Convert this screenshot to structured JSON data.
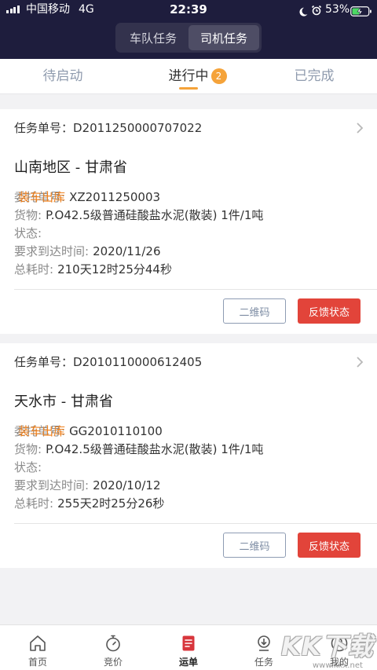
{
  "status_bar": {
    "carrier": "中国移动",
    "network": "4G",
    "time": "22:39",
    "battery": "53%",
    "icons": [
      "signal-icon",
      "moon-icon",
      "alarm-icon",
      "battery-charging-icon"
    ]
  },
  "header": {
    "segments": [
      {
        "label": "车队任务",
        "active": false
      },
      {
        "label": "司机任务",
        "active": true
      }
    ]
  },
  "tabs": [
    {
      "label": "待启动",
      "active": false
    },
    {
      "label": "进行中",
      "badge": "2",
      "active": true
    },
    {
      "label": "已完成",
      "active": false
    }
  ],
  "tasks": [
    {
      "task_no_label": "任务单号：",
      "task_no": "D2011250000707022",
      "route": "山南地区 - 甘肃省",
      "fields": [
        {
          "label": "委托单号:",
          "value": "XZ2011250003"
        },
        {
          "label": "货物:",
          "value": "P.O42.5级普通硅酸盐水泥(散装) 1件/1吨"
        },
        {
          "label": "状态:",
          "value": "装车出库"
        },
        {
          "label": "要求到达时间:",
          "value": "2020/11/26"
        },
        {
          "label": "总耗时:",
          "value": "210天12时25分44秒"
        }
      ],
      "buttons": {
        "qr": "二维码",
        "feedback": "反馈状态"
      }
    },
    {
      "task_no_label": "任务单号：",
      "task_no": "D2010110000612405",
      "route": "天水市 - 甘肃省",
      "fields": [
        {
          "label": "委托单号:",
          "value": "GG2010110100"
        },
        {
          "label": "货物:",
          "value": "P.O42.5级普通硅酸盐水泥(散装) 1件/1吨"
        },
        {
          "label": "状态:",
          "value": "装车出库"
        },
        {
          "label": "要求到达时间:",
          "value": "2020/10/12"
        },
        {
          "label": "总耗时:",
          "value": "255天2时25分26秒"
        }
      ],
      "buttons": {
        "qr": "二维码",
        "feedback": "反馈状态"
      }
    }
  ],
  "bottom_nav": [
    {
      "label": "首页",
      "icon": "home-icon",
      "active": false
    },
    {
      "label": "竞价",
      "icon": "stopwatch-icon",
      "active": false
    },
    {
      "label": "运单",
      "icon": "waybill-icon",
      "active": true
    },
    {
      "label": "任务",
      "icon": "task-icon",
      "active": false
    },
    {
      "label": "我的",
      "icon": "profile-icon",
      "active": false
    }
  ],
  "watermark": {
    "logo": "KK下载",
    "site": "www.kkx.net"
  },
  "colors": {
    "header_bg": "#1e1d3d",
    "accent_orange": "#f5a33a",
    "status_orange": "#ef801c",
    "button_red": "#e2443a",
    "nav_active_red": "#d8363c"
  }
}
